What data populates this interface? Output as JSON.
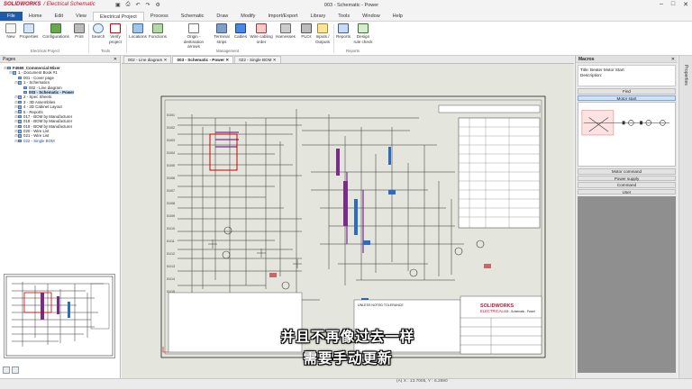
{
  "app": {
    "logo_brand": "SOLIDWORKS",
    "logo_product": "/ Electrical Schematic",
    "window_title": "003 - Schematic - Power",
    "qat_icons": [
      "save-icon",
      "print-icon",
      "undo-icon",
      "redo-icon",
      "options-icon"
    ],
    "window_controls": [
      "minimize-icon",
      "maximize-icon",
      "close-icon"
    ]
  },
  "menu": {
    "items": [
      "File",
      "Home",
      "Edit",
      "View",
      "Electrical Project",
      "Process",
      "Schematic",
      "Draw",
      "Modify",
      "Import/Export",
      "Library",
      "Tools",
      "Window",
      "Help"
    ],
    "active": "Electrical Project"
  },
  "ribbon": {
    "buttons": [
      {
        "label": "New",
        "icon": "new-icon"
      },
      {
        "label": "Properties",
        "icon": "properties-icon"
      },
      {
        "label": "Configurations",
        "icon": "configurations-icon"
      },
      {
        "label": "Print",
        "icon": "print-icon"
      },
      {
        "label": "Search",
        "icon": "search-icon"
      },
      {
        "label": "Verify project",
        "icon": "verify-icon"
      },
      {
        "label": "Locations",
        "icon": "locations-icon"
      },
      {
        "label": "Functions",
        "icon": "functions-icon"
      },
      {
        "label": "Origin - destination arrows",
        "icon": "arrows-icon"
      },
      {
        "label": "Terminal strips",
        "icon": "terminal-icon"
      },
      {
        "label": "Cables",
        "icon": "cables-icon"
      },
      {
        "label": "Wire cabling order",
        "icon": "wire-icon"
      },
      {
        "label": "Harnesses",
        "icon": "harness-icon"
      },
      {
        "label": "PLCs",
        "icon": "plc-icon"
      },
      {
        "label": "Inputs / Outputs",
        "icon": "io-icon"
      },
      {
        "label": "Reports",
        "icon": "reports-icon"
      },
      {
        "label": "Design rule check",
        "icon": "drc-icon"
      }
    ],
    "groups": [
      "Electrical Project",
      "Tools",
      "Management",
      "Reports"
    ]
  },
  "pages_panel": {
    "title": "Pages",
    "tree": [
      {
        "label": "F4669_Commercial Mixer",
        "level": 0,
        "bold": true
      },
      {
        "label": "1 - Document Book #1",
        "level": 1
      },
      {
        "label": "001 - Cover page",
        "level": 2
      },
      {
        "label": "1 - Schematics",
        "level": 2
      },
      {
        "label": "002 - Line diagram",
        "level": 3
      },
      {
        "label": "003 - Schematic - Power",
        "level": 3,
        "selected": true
      },
      {
        "label": "2 - Spec Sheets",
        "level": 2
      },
      {
        "label": "3 - 3D Assemblies",
        "level": 2
      },
      {
        "label": "4 - 2D Cabinet Layout",
        "level": 2
      },
      {
        "label": "5 - Reports",
        "level": 2
      },
      {
        "label": "017 - BOM by Manufacturer",
        "level": 2
      },
      {
        "label": "018 - BOM by Manufacturer",
        "level": 2
      },
      {
        "label": "019 - BOM by Manufacturer",
        "level": 2
      },
      {
        "label": "020 - Wire List",
        "level": 2
      },
      {
        "label": "021 - Wire List",
        "level": 2
      },
      {
        "label": "022 - Single BOM",
        "level": 2,
        "blue": true
      }
    ]
  },
  "doc_tabs": [
    {
      "label": "002 - Line diagram",
      "active": false
    },
    {
      "label": "003 - Schematic - Power",
      "active": true
    },
    {
      "label": "022 - Single BOM",
      "active": false
    }
  ],
  "drawing": {
    "row_labels": [
      "01/01",
      "01/02",
      "01/03",
      "01/04",
      "01/05",
      "01/06",
      "01/07",
      "01/08",
      "01/09",
      "01/10",
      "01/11",
      "01/12",
      "01/13",
      "01/14",
      "01/15"
    ],
    "title_block_brand": "SOLIDWORKS",
    "title_block_sub": "ELECTRICAL",
    "tolerance_note": "UNLESS NOTED TOLERANCE",
    "title_block_name": "003 - Schematic - Power",
    "subtitle_line1": "并且不再像过去一样",
    "subtitle_line2": "需要手动更新"
  },
  "macros_panel": {
    "title": "Macros",
    "info_title": "Title: Beater Motor Start",
    "info_desc": "Description:",
    "buttons_top": [
      "Find",
      "Motor start"
    ],
    "buttons_bottom": [
      "Motor command",
      "Power supply",
      "Command",
      "User"
    ],
    "selected": "Motor start"
  },
  "side_tab": "Properties",
  "status": {
    "coords": "(A) X : 13.7005, Y : 6.2690"
  }
}
